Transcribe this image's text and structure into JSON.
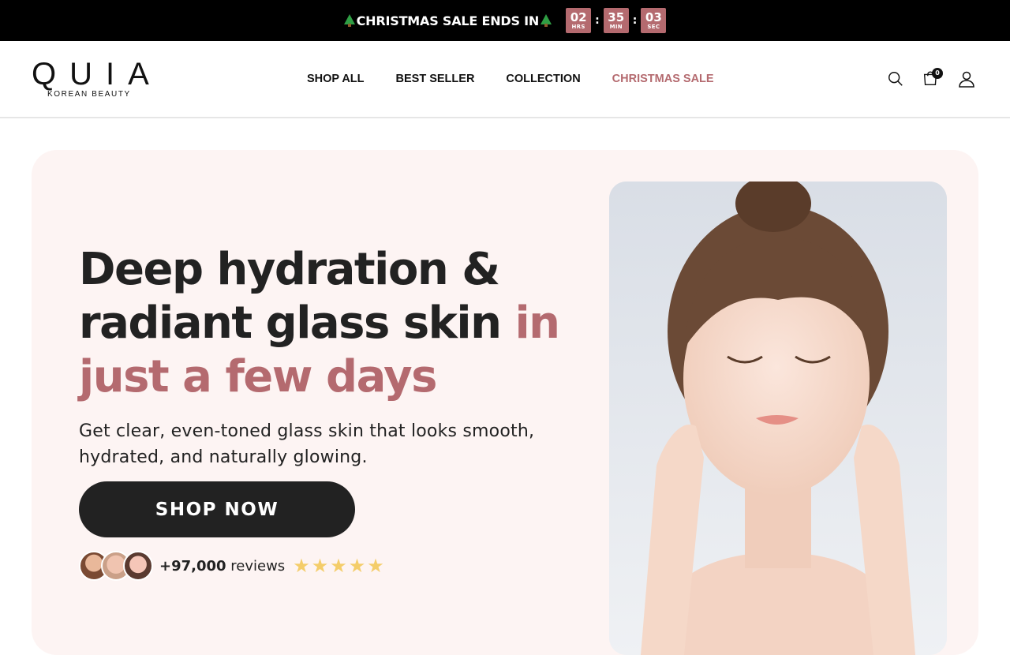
{
  "announcement": {
    "text": "CHRISTMAS SALE ENDS IN",
    "icon": "christmas-tree-icon",
    "countdown": [
      {
        "value": "02",
        "label": "HRS"
      },
      {
        "value": "35",
        "label": "MIN"
      },
      {
        "value": "03",
        "label": "SEC"
      }
    ],
    "separator": ":"
  },
  "header": {
    "logo_word": "QUIA",
    "logo_sub": "KOREAN BEAUTY",
    "nav": [
      "SHOP ALL",
      "BEST SELLER",
      "COLLECTION",
      "CHRISTMAS SALE"
    ],
    "cart_count": "0",
    "icons": [
      "search-icon",
      "cart-icon",
      "account-icon"
    ]
  },
  "hero": {
    "title_main": "Deep hydration & radiant glass skin ",
    "title_accent": "in just a few days",
    "subtitle": "Get clear, even-toned glass skin that looks smooth, hydrated, and naturally glowing.",
    "cta_label": "SHOP NOW",
    "review_count": "+97,000",
    "review_word": "reviews",
    "rating_stars": 5
  },
  "colors": {
    "accent": "#b46a6f",
    "dark": "#222222",
    "hero_bg": "#fdf4f3",
    "star": "#f4cd6a"
  }
}
